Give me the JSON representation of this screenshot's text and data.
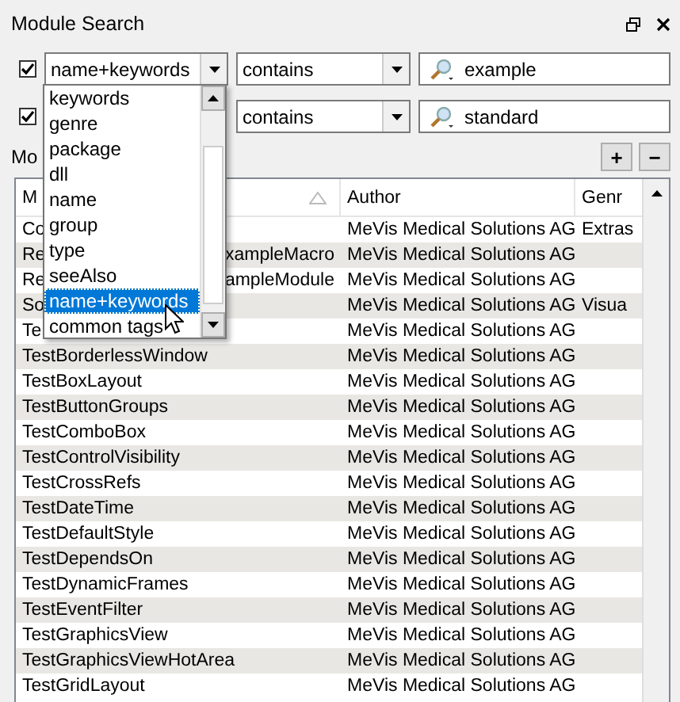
{
  "panel": {
    "title": "Module Search"
  },
  "filters": [
    {
      "checked": true,
      "field": "name+keywords",
      "operator": "contains",
      "query": "example"
    },
    {
      "checked": true,
      "operator": "contains",
      "query": "standard"
    }
  ],
  "field_dropdown": {
    "items": [
      {
        "label": "keywords",
        "selected": false
      },
      {
        "label": "genre",
        "selected": false
      },
      {
        "label": "package",
        "selected": false
      },
      {
        "label": "dll",
        "selected": false
      },
      {
        "label": "name",
        "selected": false
      },
      {
        "label": "group",
        "selected": false
      },
      {
        "label": "type",
        "selected": false
      },
      {
        "label": "seeAlso",
        "selected": false
      },
      {
        "label": "name+keywords",
        "selected": true
      },
      {
        "label": "common tags",
        "selected": false
      }
    ]
  },
  "modules_label": "Mo",
  "buttons": [
    "+",
    "−"
  ],
  "table": {
    "columns": [
      "M",
      "Author",
      "Genr"
    ],
    "rows": [
      {
        "name": "Co",
        "author": "MeVis Medical Solutions AG",
        "genre": "Extras"
      },
      {
        "name": "Re",
        "name_tail": "xampleMacro",
        "author": "MeVis Medical Solutions AG"
      },
      {
        "name": "Re",
        "name_tail": "ampleModule",
        "author": "MeVis Medical Solutions AG"
      },
      {
        "name": "So",
        "author": "MeVis Medical Solutions AG",
        "genre": "Visua"
      },
      {
        "name": "Te",
        "author": "MeVis Medical Solutions AG"
      },
      {
        "name": "TestBorderlessWindow",
        "author": "MeVis Medical Solutions AG"
      },
      {
        "name": "TestBoxLayout",
        "author": "MeVis Medical Solutions AG"
      },
      {
        "name": "TestButtonGroups",
        "author": "MeVis Medical Solutions AG"
      },
      {
        "name": "TestComboBox",
        "author": "MeVis Medical Solutions AG"
      },
      {
        "name": "TestControlVisibility",
        "author": "MeVis Medical Solutions AG"
      },
      {
        "name": "TestCrossRefs",
        "author": "MeVis Medical Solutions AG"
      },
      {
        "name": "TestDateTime",
        "author": "MeVis Medical Solutions AG"
      },
      {
        "name": "TestDefaultStyle",
        "author": "MeVis Medical Solutions AG"
      },
      {
        "name": "TestDependsOn",
        "author": "MeVis Medical Solutions AG"
      },
      {
        "name": "TestDynamicFrames",
        "author": "MeVis Medical Solutions AG"
      },
      {
        "name": "TestEventFilter",
        "author": "MeVis Medical Solutions AG"
      },
      {
        "name": "TestGraphicsView",
        "author": "MeVis Medical Solutions AG"
      },
      {
        "name": "TestGraphicsViewHotArea",
        "author": "MeVis Medical Solutions AG"
      },
      {
        "name": "TestGridLayout",
        "author": "MeVis Medical Solutions AG"
      }
    ]
  }
}
